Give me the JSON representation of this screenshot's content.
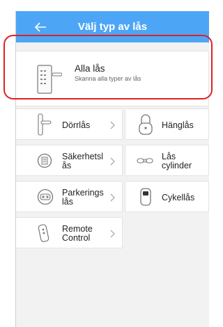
{
  "header": {
    "title": "Välj typ av lås",
    "back_icon": "arrow-left-icon",
    "color": "#4da6f5"
  },
  "all_locks": {
    "title": "Alla lås",
    "subtitle": "Skanna alla typer av lås",
    "icon": "smart-door-lock-icon"
  },
  "lock_types": [
    {
      "label": "Dörrlås",
      "icon": "door-handle-icon"
    },
    {
      "label": "Hänglås",
      "icon": "padlock-icon"
    },
    {
      "label": "Säkerhetsl\nås",
      "icon": "safe-icon"
    },
    {
      "label": "Lås\ncylinder",
      "icon": "lock-cylinder-icon"
    },
    {
      "label": "Parkerings\nlås",
      "icon": "parking-lock-icon"
    },
    {
      "label": "Cykellås",
      "icon": "bicycle-lock-icon"
    },
    {
      "label": "Remote\nControl",
      "icon": "remote-control-icon"
    }
  ],
  "highlight_color": "#e02020"
}
